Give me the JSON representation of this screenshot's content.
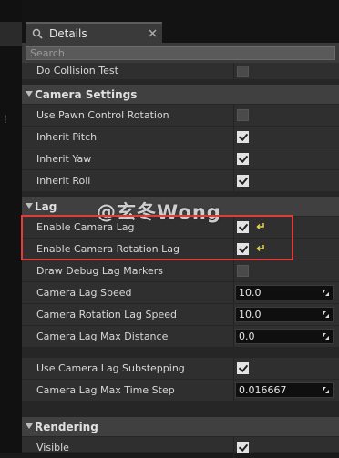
{
  "tabs": [
    {
      "label": "Details"
    }
  ],
  "search": {
    "placeholder": "Search"
  },
  "watermark": "@玄冬Wong",
  "sections": {
    "top_rows": [
      {
        "label": "Do Collision Test",
        "checked": false
      }
    ],
    "camera_settings": {
      "title": "Camera Settings",
      "rows": [
        {
          "label": "Use Pawn Control Rotation",
          "checked": false
        },
        {
          "label": "Inherit Pitch",
          "checked": true
        },
        {
          "label": "Inherit Yaw",
          "checked": true
        },
        {
          "label": "Inherit Roll",
          "checked": true
        }
      ]
    },
    "lag": {
      "title": "Lag",
      "rows": [
        {
          "label": "Enable Camera Lag",
          "checked": true,
          "reset": true
        },
        {
          "label": "Enable Camera Rotation Lag",
          "checked": true,
          "reset": true
        },
        {
          "label": "Draw Debug Lag Markers",
          "checked": false
        },
        {
          "label": "Camera Lag Speed",
          "value": "10.0"
        },
        {
          "label": "Camera Rotation Lag Speed",
          "value": "10.0"
        },
        {
          "label": "Camera Lag Max Distance",
          "value": "0.0"
        }
      ],
      "advanced_rows": [
        {
          "label": "Use Camera Lag Substepping",
          "checked": true
        },
        {
          "label": "Camera Lag Max Time Step",
          "value": "0.016667"
        }
      ]
    },
    "rendering": {
      "title": "Rendering",
      "rows": [
        {
          "label": "Visible",
          "checked": true
        }
      ]
    }
  },
  "colors": {
    "highlight": "#e33a3a",
    "reset_icon": "#e8d44d"
  }
}
